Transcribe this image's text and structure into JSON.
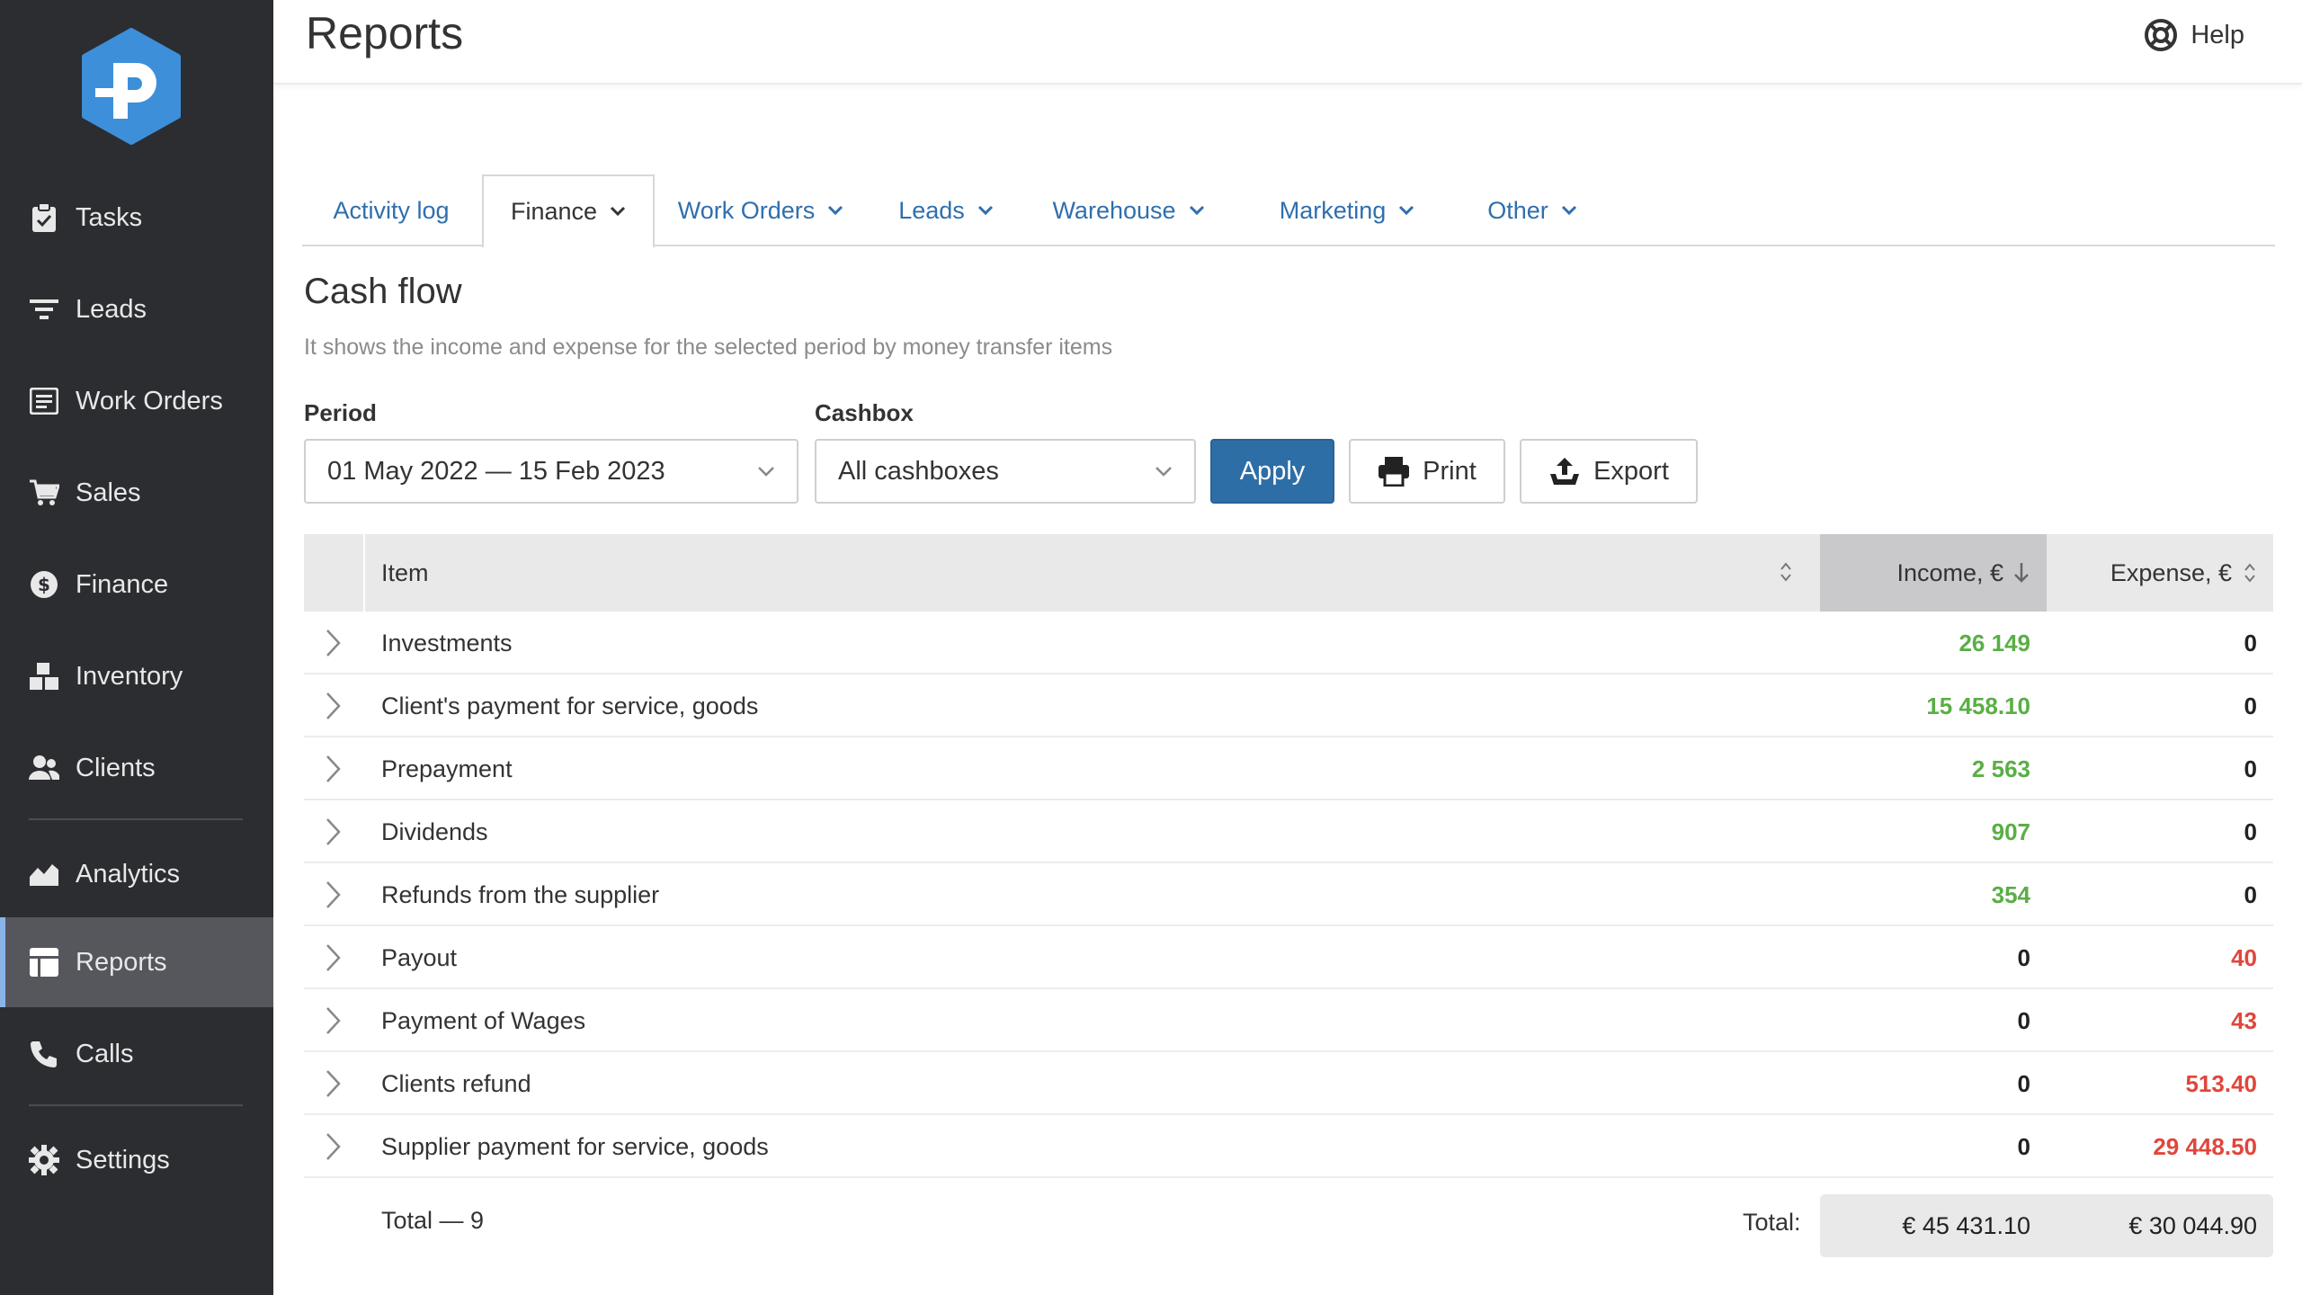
{
  "page": {
    "title": "Reports",
    "help_label": "Help"
  },
  "sidebar": {
    "items": [
      {
        "label": "Tasks",
        "icon": "clipboard-check-icon"
      },
      {
        "label": "Leads",
        "icon": "filter-icon"
      },
      {
        "label": "Work Orders",
        "icon": "work-order-icon"
      },
      {
        "label": "Sales",
        "icon": "cart-icon"
      },
      {
        "label": "Finance",
        "icon": "dollar-icon"
      },
      {
        "label": "Inventory",
        "icon": "boxes-icon"
      },
      {
        "label": "Clients",
        "icon": "users-icon"
      },
      {
        "label": "Analytics",
        "icon": "chart-area-icon"
      },
      {
        "label": "Reports",
        "icon": "reports-icon"
      },
      {
        "label": "Calls",
        "icon": "phone-icon"
      },
      {
        "label": "Settings",
        "icon": "gear-icon"
      }
    ],
    "active": "Reports",
    "accent_color": "#8ab4e8",
    "logo_color": "#3d8fd9"
  },
  "tabs": [
    {
      "label": "Activity log"
    },
    {
      "label": "Finance",
      "active": true
    },
    {
      "label": "Work Orders"
    },
    {
      "label": "Leads"
    },
    {
      "label": "Warehouse"
    },
    {
      "label": "Marketing"
    },
    {
      "label": "Other"
    }
  ],
  "report": {
    "title": "Cash flow",
    "description": "It shows the income and expense for the selected period by money transfer items",
    "period_label": "Period",
    "period_value": "01 May 2022 — 15 Feb 2023",
    "cashbox_label": "Cashbox",
    "cashbox_value": "All cashboxes",
    "apply_label": "Apply",
    "print_label": "Print",
    "export_label": "Export"
  },
  "table": {
    "columns": {
      "item": "Item",
      "income": "Income, €",
      "expense": "Expense, €"
    },
    "rows": [
      {
        "item": "Investments",
        "income": "26 149",
        "expense": "0"
      },
      {
        "item": "Client's payment for service, goods",
        "income": "15 458.10",
        "expense": "0"
      },
      {
        "item": "Prepayment",
        "income": "2 563",
        "expense": "0"
      },
      {
        "item": "Dividends",
        "income": "907",
        "expense": "0"
      },
      {
        "item": "Refunds from the supplier",
        "income": "354",
        "expense": "0"
      },
      {
        "item": "Payout",
        "income": "0",
        "expense": "40"
      },
      {
        "item": "Payment of Wages",
        "income": "0",
        "expense": "43"
      },
      {
        "item": "Clients refund",
        "income": "0",
        "expense": "513.40"
      },
      {
        "item": "Supplier payment for service, goods",
        "income": "0",
        "expense": "29 448.50"
      }
    ],
    "total_count_label": "Total — 9",
    "total_label": "Total:",
    "total_income": "€ 45 431.10",
    "total_expense": "€ 30 044.90",
    "income_color": "#5aae46",
    "expense_color": "#e0463c"
  }
}
